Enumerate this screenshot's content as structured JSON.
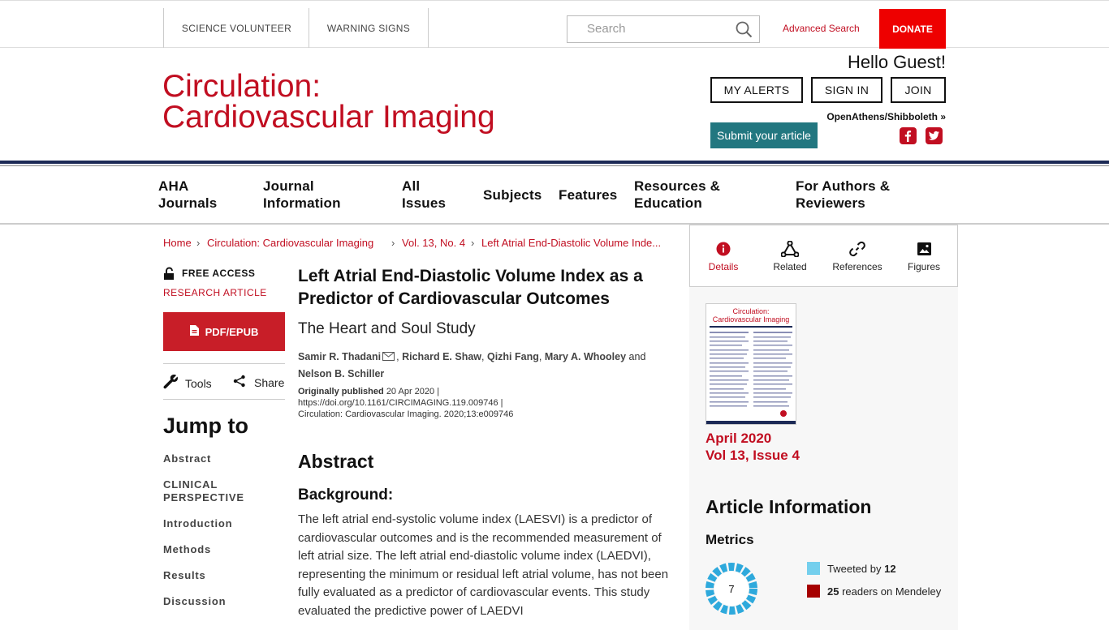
{
  "topbar": {
    "links": [
      "SCIENCE VOLUNTEER",
      "WARNING SIGNS"
    ],
    "search_placeholder": "Search",
    "advanced_search": "Advanced Search",
    "donate": "DONATE"
  },
  "header": {
    "logo_line1": "Circulation:",
    "logo_line2": "Cardiovascular Imaging",
    "greeting": "Hello Guest!",
    "buttons": [
      "MY ALERTS",
      "SIGN IN",
      "JOIN"
    ],
    "openathens": "OpenAthens/Shibboleth »",
    "submit": "Submit your article"
  },
  "mainnav": [
    {
      "line1": "AHA",
      "line2": "Journals"
    },
    {
      "line1": "Journal",
      "line2": "Information"
    },
    {
      "line1": "All",
      "line2": "Issues"
    },
    {
      "line1": "Subjects",
      "line2": ""
    },
    {
      "line1": "Features",
      "line2": ""
    },
    {
      "line1": "Resources &",
      "line2": "Education"
    },
    {
      "line1": "For Authors &",
      "line2": "Reviewers"
    }
  ],
  "breadcrumb": [
    "Home",
    "Circulation: Cardiovascular Imaging",
    "Vol. 13, No. 4",
    "Left Atrial End-Diastolic Volume Inde..."
  ],
  "leftcol": {
    "free_access": "FREE ACCESS",
    "article_type": "RESEARCH ARTICLE",
    "pdf": "PDF/EPUB",
    "tools": "Tools",
    "share": "Share",
    "jump_to": "Jump to",
    "jump_items": [
      "Abstract",
      "CLINICAL PERSPECTIVE",
      "Introduction",
      "Methods",
      "Results",
      "Discussion"
    ]
  },
  "article": {
    "title": "Left Atrial End-Diastolic Volume Index as a Predictor of Cardiovascular Outcomes",
    "subtitle": "The Heart and Soul Study",
    "authors": [
      "Samir R. Thadani",
      "Richard E. Shaw",
      "Qizhi Fang",
      "Mary A. Whooley",
      "Nelson B. Schiller"
    ],
    "and": "and",
    "published_label": "Originally published",
    "published_date": "20 Apr 2020",
    "doi": "https://doi.org/10.1161/CIRCIMAGING.119.009746",
    "citation": "Circulation: Cardiovascular Imaging. 2020;13:e009746",
    "abstract_heading": "Abstract",
    "background_heading": "Background:",
    "abstract_text": "The left atrial end-systolic volume index (LAESVI) is a predictor of cardiovascular outcomes and is the recommended measurement of left atrial size. The left atrial end-diastolic volume index (LAEDVI), representing the minimum or residual left atrial volume, has not been fully evaluated as a predictor of cardiovascular events. This study evaluated the predictive power of LAEDVI"
  },
  "rightpanel": {
    "tabs": [
      "Details",
      "Related",
      "References",
      "Figures"
    ],
    "active_tab": "Details",
    "cover_title_1": "Circulation:",
    "cover_title_2": "Cardiovascular Imaging",
    "issue_date": "April 2020",
    "issue_vol": "Vol 13, Issue 4",
    "article_info": "Article Information",
    "metrics": "Metrics",
    "altmetric_score": "7",
    "tweeted_label": "Tweeted by",
    "tweeted_count": "12",
    "mendeley_count": "25",
    "mendeley_label": "readers on Mendeley"
  },
  "colors": {
    "brand_red": "#c10e21",
    "donate_red": "#ee0000",
    "teal": "#227780",
    "navy_rule": "#1c2a56",
    "twitter_swatch": "#74cfed",
    "mendeley_swatch": "#a60000"
  }
}
